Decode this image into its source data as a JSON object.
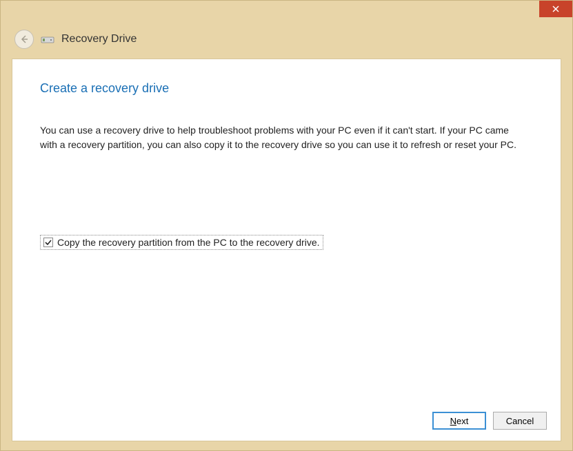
{
  "header": {
    "title": "Recovery Drive"
  },
  "page": {
    "title": "Create a recovery drive",
    "description": "You can use a recovery drive to help troubleshoot problems with your PC even if it can't start. If your PC came with a recovery partition, you can also copy it to the recovery drive so you can use it to refresh or reset your PC."
  },
  "checkbox": {
    "label": "Copy the recovery partition from the PC to the recovery drive.",
    "checked": true
  },
  "buttons": {
    "next_prefix": "N",
    "next_suffix": "ext",
    "cancel": "Cancel"
  }
}
